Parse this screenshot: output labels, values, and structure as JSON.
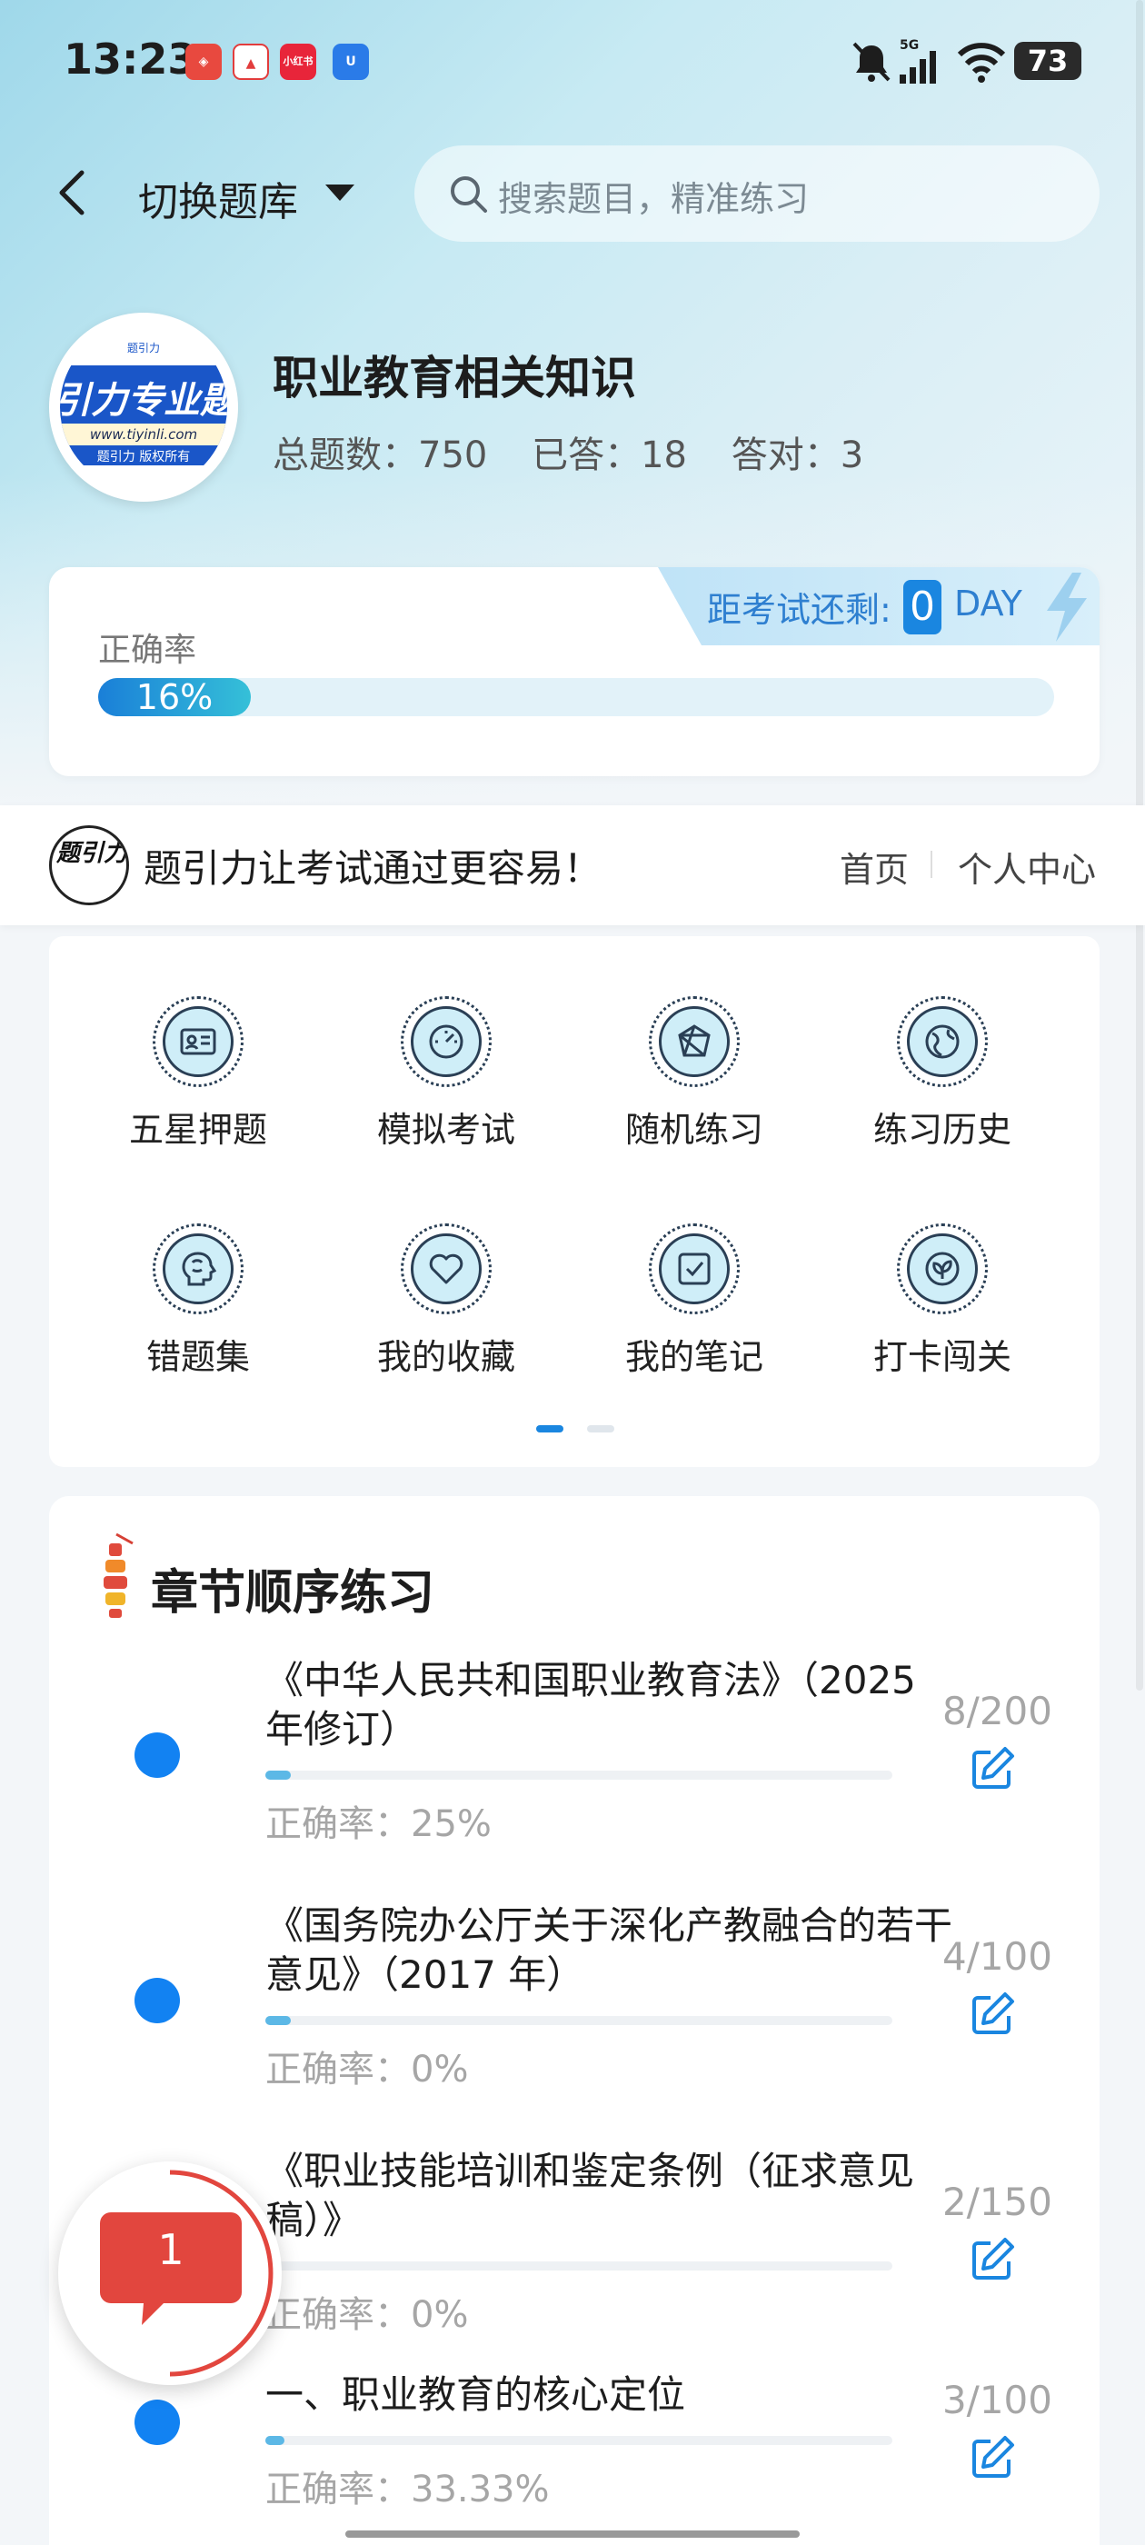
{
  "status": {
    "time": "13:23",
    "battery": "73",
    "network": "5G"
  },
  "nav": {
    "switch_label": "切换题库",
    "search_placeholder": "搜索题目，精准练习"
  },
  "bank": {
    "logo_text": "引力专业题",
    "logo_url": "www.tiyinli.com",
    "logo_copyright": "题引力 版权所有",
    "logo_top": "题引力",
    "title": "职业教育相关知识",
    "total": "总题数：750",
    "answered": "已答：18",
    "correct": "答对：3"
  },
  "accuracy": {
    "label": "正确率",
    "percent_text": "16%",
    "percent": 16,
    "countdown_label": "距考试还剩:",
    "countdown_value": "0",
    "countdown_unit": "DAY"
  },
  "banner": {
    "logo_text": "题引力",
    "slogan": "题引力让考试通过更容易！",
    "home": "首页",
    "personal_center": "个人中心"
  },
  "features": [
    {
      "label": "五星押题",
      "icon": "id-card-icon"
    },
    {
      "label": "模拟考试",
      "icon": "gauge-icon"
    },
    {
      "label": "随机练习",
      "icon": "network-icon"
    },
    {
      "label": "练习历史",
      "icon": "globe-icon"
    },
    {
      "label": "错题集",
      "icon": "brain-head-icon"
    },
    {
      "label": "我的收藏",
      "icon": "heart-icon"
    },
    {
      "label": "我的笔记",
      "icon": "note-check-icon"
    },
    {
      "label": "打卡闯关",
      "icon": "leaf-badge-icon"
    }
  ],
  "chapters": {
    "title": "章节顺序练习",
    "items": [
      {
        "name": "《中华人民共和国职业教育法》（2025 年修订）",
        "rate": "正确率：25%",
        "count": "8/200",
        "progress": 0.04
      },
      {
        "name": "《国务院办公厅关于深化产教融合的若干意见》（2017 年）",
        "rate": "正确率：0%",
        "count": "4/100",
        "progress": 0.04
      },
      {
        "name": "《职业技能培训和鉴定条例（征求意见稿）》",
        "rate": "正确率：0%",
        "count": "2/150",
        "progress": 0.013
      },
      {
        "name": "一、职业教育的核心定位",
        "rate": "正确率：33.33%",
        "count": "3/100",
        "progress": 0.03
      }
    ]
  },
  "float_badge": {
    "count": "1"
  },
  "colors": {
    "accent": "#1282f2",
    "progress_start": "#1a7fd8",
    "progress_end": "#35c0d8",
    "badge_red": "#e2463e"
  }
}
